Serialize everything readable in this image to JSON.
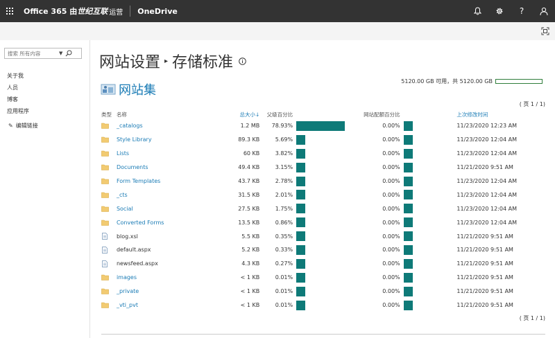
{
  "suite": {
    "brand_main": "Office 365 由",
    "brand_op": "世纪互联",
    "brand_suffix": "运营",
    "app_name": "OneDrive",
    "icons": [
      "bell-icon",
      "gear-icon",
      "help-icon",
      "user-icon"
    ],
    "help_glyph": "?"
  },
  "nav": {
    "search_placeholder": "搜索 所有内容",
    "items": [
      "关于我",
      "人员",
      "博客",
      "应用程序"
    ],
    "edit_links": "编辑链接"
  },
  "page": {
    "title_part1": "网站设置",
    "title_part2": "存储标准",
    "site_name": "网站集",
    "quota_text": "5120.00 GB 可用，共 5120.00 GB",
    "quota_used_fraction": 0.0,
    "pager_text": "( 页 1 / 1)",
    "colors": {
      "accent": "#1a7bb5",
      "bar": "#0e7a78",
      "quota": "#2e7d3a"
    }
  },
  "table": {
    "headers": {
      "type": "类型",
      "name": "名称",
      "size": "总大小↓",
      "parent_pct": "父级百分比",
      "quota_pct": "网站配额百分比",
      "modified": "上次修改时间"
    },
    "rows": [
      {
        "kind": "folder",
        "name": "_catalogs",
        "size": "1.2 MB",
        "parent_pct": "78.93%",
        "parent_val": 78.93,
        "quota_pct": "0.00%",
        "modified": "11/23/2020 12:23 AM"
      },
      {
        "kind": "folder",
        "name": "Style Library",
        "size": "89.3 KB",
        "parent_pct": "5.69%",
        "parent_val": 5.69,
        "quota_pct": "0.00%",
        "modified": "11/23/2020 12:04 AM"
      },
      {
        "kind": "folder",
        "name": "Lists",
        "size": "60 KB",
        "parent_pct": "3.82%",
        "parent_val": 3.82,
        "quota_pct": "0.00%",
        "modified": "11/23/2020 12:04 AM"
      },
      {
        "kind": "folder",
        "name": "Documents",
        "size": "49.4 KB",
        "parent_pct": "3.15%",
        "parent_val": 3.15,
        "quota_pct": "0.00%",
        "modified": "11/21/2020 9:51 AM"
      },
      {
        "kind": "folder",
        "name": "Form Templates",
        "size": "43.7 KB",
        "parent_pct": "2.78%",
        "parent_val": 2.78,
        "quota_pct": "0.00%",
        "modified": "11/23/2020 12:04 AM"
      },
      {
        "kind": "folder",
        "name": "_cts",
        "size": "31.5 KB",
        "parent_pct": "2.01%",
        "parent_val": 2.01,
        "quota_pct": "0.00%",
        "modified": "11/23/2020 12:04 AM"
      },
      {
        "kind": "folder",
        "name": "Social",
        "size": "27.5 KB",
        "parent_pct": "1.75%",
        "parent_val": 1.75,
        "quota_pct": "0.00%",
        "modified": "11/23/2020 12:04 AM"
      },
      {
        "kind": "folder",
        "name": "Converted Forms",
        "size": "13.5 KB",
        "parent_pct": "0.86%",
        "parent_val": 0.86,
        "quota_pct": "0.00%",
        "modified": "11/23/2020 12:04 AM"
      },
      {
        "kind": "file",
        "name": "blog.xsl",
        "size": "5.5 KB",
        "parent_pct": "0.35%",
        "parent_val": 0.35,
        "quota_pct": "0.00%",
        "modified": "11/21/2020 9:51 AM"
      },
      {
        "kind": "file",
        "name": "default.aspx",
        "size": "5.2 KB",
        "parent_pct": "0.33%",
        "parent_val": 0.33,
        "quota_pct": "0.00%",
        "modified": "11/21/2020 9:51 AM"
      },
      {
        "kind": "file",
        "name": "newsfeed.aspx",
        "size": "4.3 KB",
        "parent_pct": "0.27%",
        "parent_val": 0.27,
        "quota_pct": "0.00%",
        "modified": "11/21/2020 9:51 AM"
      },
      {
        "kind": "folder",
        "name": "images",
        "size": "< 1 KB",
        "parent_pct": "0.01%",
        "parent_val": 0.01,
        "quota_pct": "0.00%",
        "modified": "11/21/2020 9:51 AM"
      },
      {
        "kind": "folder",
        "name": "_private",
        "size": "< 1 KB",
        "parent_pct": "0.01%",
        "parent_val": 0.01,
        "quota_pct": "0.00%",
        "modified": "11/21/2020 9:51 AM"
      },
      {
        "kind": "folder",
        "name": "_vti_pvt",
        "size": "< 1 KB",
        "parent_pct": "0.01%",
        "parent_val": 0.01,
        "quota_pct": "0.00%",
        "modified": "11/21/2020 9:51 AM"
      }
    ]
  }
}
